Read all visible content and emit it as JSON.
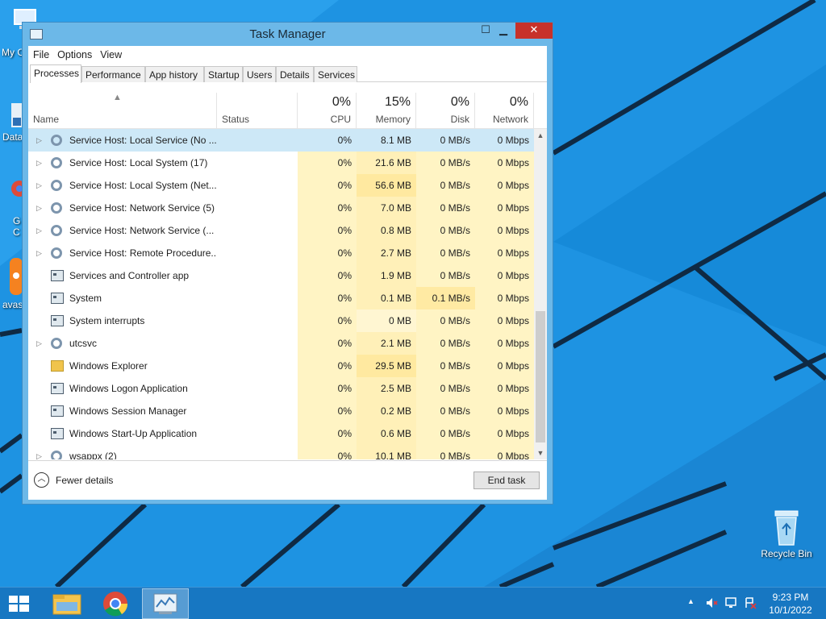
{
  "window": {
    "title": "Task Manager"
  },
  "menu": [
    "File",
    "Options",
    "View"
  ],
  "tabs": [
    "Processes",
    "Performance",
    "App history",
    "Startup",
    "Users",
    "Details",
    "Services"
  ],
  "columns": {
    "name": "Name",
    "status": "Status",
    "cpu": {
      "pct": "0%",
      "label": "CPU"
    },
    "memory": {
      "pct": "15%",
      "label": "Memory"
    },
    "disk": {
      "pct": "0%",
      "label": "Disk"
    },
    "network": {
      "pct": "0%",
      "label": "Network"
    }
  },
  "processes": [
    {
      "name": "Service Host: Local Service (No ...",
      "icon": "gear-icon",
      "expandable": true,
      "cpu": "0%",
      "memory": "8.1 MB",
      "disk": "0 MB/s",
      "network": "0 Mbps",
      "selected": true
    },
    {
      "name": "Service Host: Local System (17)",
      "icon": "gear-icon",
      "expandable": true,
      "cpu": "0%",
      "memory": "21.6 MB",
      "disk": "0 MB/s",
      "network": "0 Mbps"
    },
    {
      "name": "Service Host: Local System (Net...",
      "icon": "gear-icon",
      "expandable": true,
      "cpu": "0%",
      "memory": "56.6 MB",
      "disk": "0 MB/s",
      "network": "0 Mbps"
    },
    {
      "name": "Service Host: Network Service (5)",
      "icon": "gear-icon",
      "expandable": true,
      "cpu": "0%",
      "memory": "7.0 MB",
      "disk": "0 MB/s",
      "network": "0 Mbps"
    },
    {
      "name": "Service Host: Network Service (...",
      "icon": "gear-icon",
      "expandable": true,
      "cpu": "0%",
      "memory": "0.8 MB",
      "disk": "0 MB/s",
      "network": "0 Mbps"
    },
    {
      "name": "Service Host: Remote Procedure...",
      "icon": "gear-icon",
      "expandable": true,
      "cpu": "0%",
      "memory": "2.7 MB",
      "disk": "0 MB/s",
      "network": "0 Mbps"
    },
    {
      "name": "Services and Controller app",
      "icon": "window-icon",
      "expandable": false,
      "cpu": "0%",
      "memory": "1.9 MB",
      "disk": "0 MB/s",
      "network": "0 Mbps"
    },
    {
      "name": "System",
      "icon": "window-icon",
      "expandable": false,
      "cpu": "0%",
      "memory": "0.1 MB",
      "disk": "0.1 MB/s",
      "network": "0 Mbps"
    },
    {
      "name": "System interrupts",
      "icon": "window-icon",
      "expandable": false,
      "cpu": "0%",
      "memory": "0 MB",
      "disk": "0 MB/s",
      "network": "0 Mbps"
    },
    {
      "name": "utcsvc",
      "icon": "gear-icon",
      "expandable": true,
      "cpu": "0%",
      "memory": "2.1 MB",
      "disk": "0 MB/s",
      "network": "0 Mbps"
    },
    {
      "name": "Windows Explorer",
      "icon": "folder-icon",
      "expandable": false,
      "cpu": "0%",
      "memory": "29.5 MB",
      "disk": "0 MB/s",
      "network": "0 Mbps"
    },
    {
      "name": "Windows Logon Application",
      "icon": "window-icon",
      "expandable": false,
      "cpu": "0%",
      "memory": "2.5 MB",
      "disk": "0 MB/s",
      "network": "0 Mbps"
    },
    {
      "name": "Windows Session Manager",
      "icon": "window-icon",
      "expandable": false,
      "cpu": "0%",
      "memory": "0.2 MB",
      "disk": "0 MB/s",
      "network": "0 Mbps"
    },
    {
      "name": "Windows Start-Up Application",
      "icon": "window-icon",
      "expandable": false,
      "cpu": "0%",
      "memory": "0.6 MB",
      "disk": "0 MB/s",
      "network": "0 Mbps"
    },
    {
      "name": "wsappx (2)",
      "icon": "gear-icon",
      "expandable": true,
      "cpu": "0%",
      "memory": "10.1 MB",
      "disk": "0 MB/s",
      "network": "0 Mbps"
    }
  ],
  "footer": {
    "fewer_details": "Fewer details",
    "end_task": "End task"
  },
  "desktop": {
    "icons": [
      {
        "label": "My C",
        "icon": "computer-icon"
      },
      {
        "label": "Data",
        "icon": "shortcut-icon"
      },
      {
        "label": "G C",
        "icon": "chrome-icon"
      },
      {
        "label": "avas",
        "icon": "avast-icon"
      },
      {
        "label": "Recycle Bin",
        "icon": "recycle-bin-icon"
      }
    ]
  },
  "taskbar": {
    "items": [
      "start-icon",
      "file-explorer-icon",
      "chrome-icon",
      "task-manager-icon"
    ],
    "time": "9:23 PM",
    "date": "10/1/2022"
  },
  "colors": {
    "desktop": "#1c8fe0",
    "taskbar": "#1777c2",
    "close": "#c7312a",
    "selected_row": "#cde8f7",
    "heat": "#fff4c4"
  }
}
